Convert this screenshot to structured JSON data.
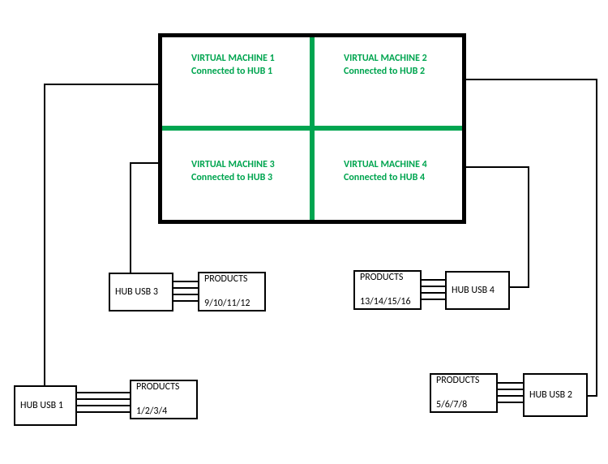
{
  "vms": [
    {
      "title": "VIRTUAL MACHINE 1",
      "sub": "Connected to HUB 1"
    },
    {
      "title": "VIRTUAL MACHINE 2",
      "sub": "Connected to HUB 2"
    },
    {
      "title": "VIRTUAL MACHINE 3",
      "sub": "Connected to HUB 3"
    },
    {
      "title": "VIRTUAL MACHINE 4",
      "sub": "Connected to HUB 4"
    }
  ],
  "hubs": [
    {
      "label": "HUB USB 1"
    },
    {
      "label": "HUB USB 2"
    },
    {
      "label": "HUB USB 3"
    },
    {
      "label": "HUB USB 4"
    }
  ],
  "products": [
    {
      "l1": "PRODUCTS",
      "l2": "1/2/3/4"
    },
    {
      "l1": "PRODUCTS",
      "l2": "5/6/7/8"
    },
    {
      "l1": "PRODUCTS",
      "l2": "9/10/11/12"
    },
    {
      "l1": "PRODUCTS",
      "l2": "13/14/15/16"
    }
  ],
  "colors": {
    "accent": "#00a550",
    "border": "#000000"
  }
}
